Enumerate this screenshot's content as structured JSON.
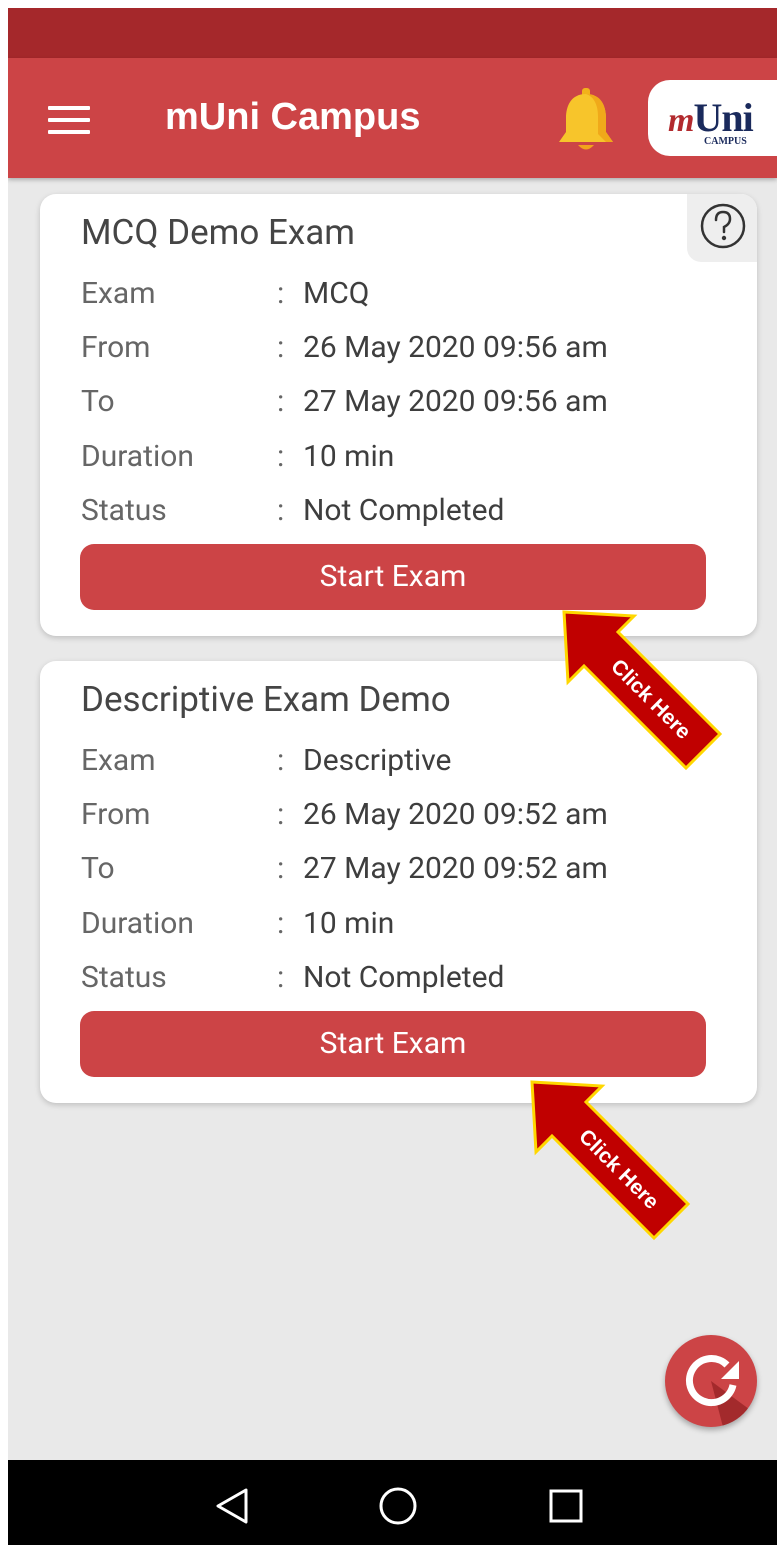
{
  "app_bar": {
    "title": "mUni Campus",
    "logo_mark": "Uni",
    "logo_prefix": "m",
    "logo_sub": "CAMPUS"
  },
  "exams": [
    {
      "title": "MCQ Demo Exam",
      "rows": [
        {
          "label": "Exam",
          "value": "MCQ"
        },
        {
          "label": "From",
          "value": "26 May 2020 09:56 am"
        },
        {
          "label": "To",
          "value": "27 May 2020 09:56 am"
        },
        {
          "label": "Duration",
          "value": "10 min"
        },
        {
          "label": "Status",
          "value": "Not Completed"
        }
      ],
      "button_label": "Start Exam"
    },
    {
      "title": "Descriptive Exam Demo",
      "rows": [
        {
          "label": "Exam",
          "value": "Descriptive"
        },
        {
          "label": "From",
          "value": "26 May 2020 09:52 am"
        },
        {
          "label": "To",
          "value": "27 May 2020 09:52 am"
        },
        {
          "label": "Duration",
          "value": "10 min"
        },
        {
          "label": "Status",
          "value": "Not Completed"
        }
      ],
      "button_label": "Start Exam"
    }
  ],
  "separator": ":",
  "callouts": [
    "Click Here",
    "Click Here"
  ],
  "colors": {
    "status_bar": "#a5282b",
    "primary": "#cc4446",
    "callout_fill": "#c00000",
    "callout_border": "#ffd700"
  },
  "icons": [
    "menu-icon",
    "bell-icon",
    "help-icon",
    "refresh-icon",
    "back-icon",
    "home-icon",
    "recents-icon"
  ]
}
